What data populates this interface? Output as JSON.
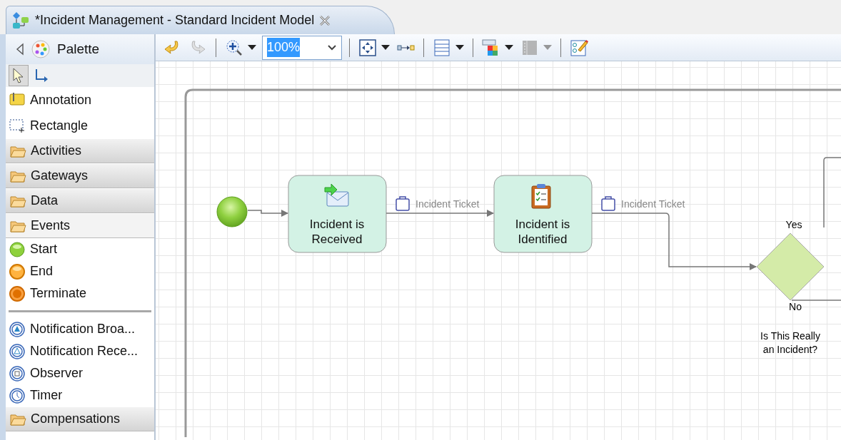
{
  "editor_tab": {
    "title": "*Incident Management - Standard Incident Model",
    "dirty": true
  },
  "palette": {
    "title": "Palette",
    "tools": [
      {
        "kind": "select",
        "selected": true
      },
      {
        "kind": "connect",
        "selected": false
      }
    ],
    "items": [
      {
        "kind": "annotation",
        "label": "Annotation"
      },
      {
        "kind": "rectangle",
        "label": "Rectangle"
      },
      {
        "kind": "drawer",
        "label": "Activities",
        "expanded": false
      },
      {
        "kind": "drawer",
        "label": "Gateways",
        "expanded": false
      },
      {
        "kind": "drawer",
        "label": "Data",
        "expanded": false
      },
      {
        "kind": "drawer",
        "label": "Events",
        "expanded": true
      },
      {
        "kind": "start",
        "label": "Start"
      },
      {
        "kind": "end",
        "label": "End"
      },
      {
        "kind": "terminate",
        "label": "Terminate"
      },
      {
        "kind": "separator"
      },
      {
        "kind": "broadcast",
        "label": "Notification Broa..."
      },
      {
        "kind": "receive",
        "label": "Notification Rece..."
      },
      {
        "kind": "observer",
        "label": "Observer"
      },
      {
        "kind": "timer",
        "label": "Timer"
      },
      {
        "kind": "drawer",
        "label": "Compensations",
        "expanded": false
      }
    ]
  },
  "toolbar": [
    {
      "kind": "undo",
      "disabled": false
    },
    {
      "kind": "redo",
      "disabled": true
    },
    {
      "kind": "separator"
    },
    {
      "kind": "zoom",
      "disabled": false,
      "dropdown": true
    },
    {
      "kind": "zoom_field",
      "value": "100%",
      "highlighted": true
    },
    {
      "kind": "separator"
    },
    {
      "kind": "fit",
      "disabled": false,
      "dropdown": true
    },
    {
      "kind": "connector",
      "disabled": false
    },
    {
      "kind": "separator"
    },
    {
      "kind": "list",
      "disabled": false,
      "dropdown": true
    },
    {
      "kind": "separator"
    },
    {
      "kind": "layers",
      "disabled": false,
      "dropdown": true
    },
    {
      "kind": "columns",
      "disabled": true,
      "dropdown": true
    },
    {
      "kind": "separator"
    },
    {
      "kind": "properties",
      "disabled": false
    }
  ],
  "diagram": {
    "start_event": true,
    "tasks": [
      {
        "name": "Incident is Received",
        "kind": "message"
      },
      {
        "name": "Incident is Identified",
        "kind": "checklist"
      }
    ],
    "data_labels": [
      "Incident Ticket",
      "Incident Ticket"
    ],
    "gateway": {
      "name": "Is This Really an Incident?",
      "yes": "Yes",
      "no": "No"
    }
  }
}
